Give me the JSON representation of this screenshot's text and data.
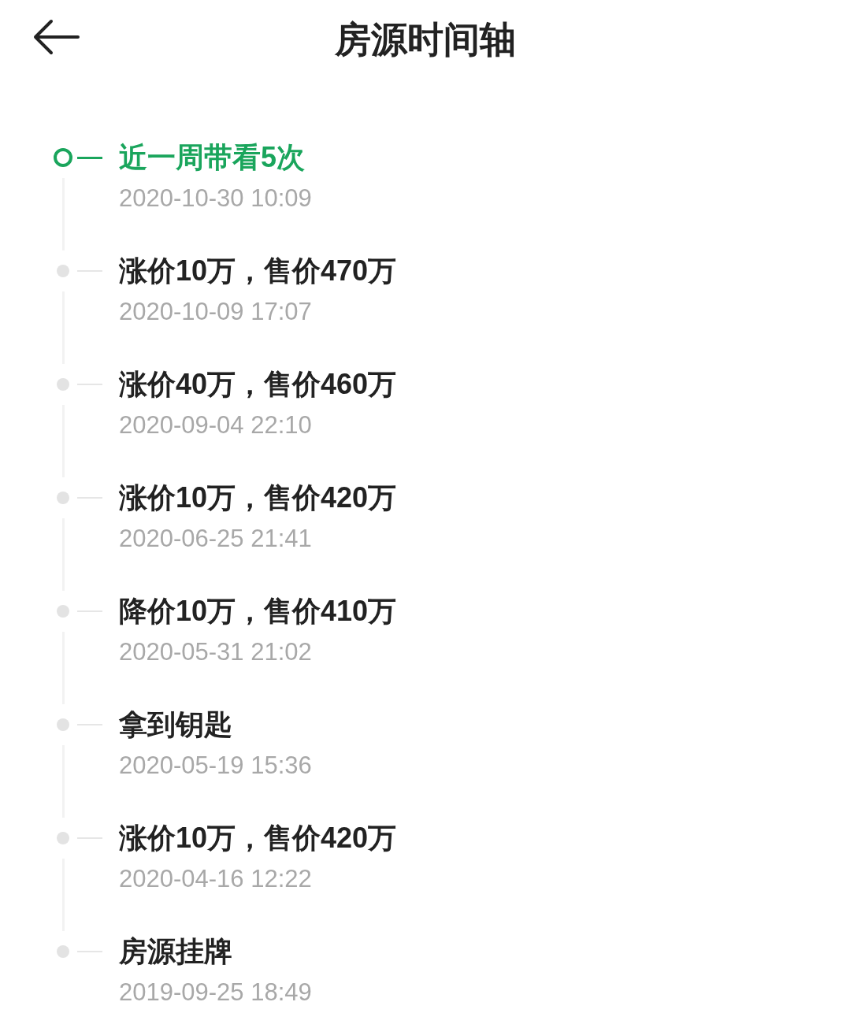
{
  "header": {
    "title": "房源时间轴"
  },
  "timeline": [
    {
      "title": "近一周带看5次",
      "time": "2020-10-30 10:09",
      "current": true
    },
    {
      "title": "涨价10万，售价470万",
      "time": "2020-10-09 17:07",
      "current": false
    },
    {
      "title": "涨价40万，售价460万",
      "time": "2020-09-04 22:10",
      "current": false
    },
    {
      "title": "涨价10万，售价420万",
      "time": "2020-06-25 21:41",
      "current": false
    },
    {
      "title": "降价10万，售价410万",
      "time": "2020-05-31 21:02",
      "current": false
    },
    {
      "title": "拿到钥匙",
      "time": "2020-05-19 15:36",
      "current": false
    },
    {
      "title": "涨价10万，售价420万",
      "time": "2020-04-16 12:22",
      "current": false
    },
    {
      "title": "房源挂牌",
      "time": "2019-09-25 18:49",
      "current": false
    }
  ]
}
